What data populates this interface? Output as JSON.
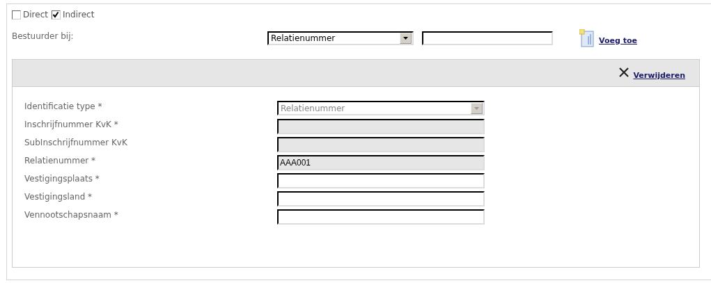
{
  "options": [
    {
      "label": "Direct",
      "checked": false
    },
    {
      "label": "Indirect",
      "checked": true
    }
  ],
  "bestuurder": {
    "label": "Bestuurder bij:",
    "select_value": "Relatienummer",
    "add_link": "Voeg toe"
  },
  "panel": {
    "remove_link": "Verwijderen",
    "fields": [
      {
        "label": "Identificatie type *",
        "kind": "select",
        "disabled": true,
        "value": "Relatienummer"
      },
      {
        "label": "Inschrijfnummer KvK *",
        "kind": "text",
        "disabled": true
      },
      {
        "label": "SubInschrijfnummer KvK",
        "kind": "text",
        "disabled": true
      },
      {
        "label": "Relatienummer *",
        "kind": "text",
        "disabled": true,
        "value": "AAA001"
      },
      {
        "label": "Vestigingsplaats *",
        "kind": "text",
        "disabled": false
      },
      {
        "label": "Vestigingsland *",
        "kind": "text",
        "disabled": false
      },
      {
        "label": "Vennootschapsnaam *",
        "kind": "text",
        "disabled": false
      }
    ]
  }
}
